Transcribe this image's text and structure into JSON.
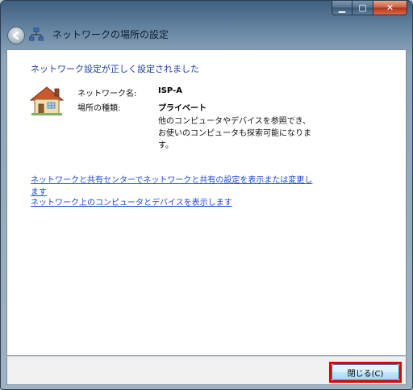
{
  "window": {
    "title": "ネットワークの場所の設定",
    "caption_buttons": {
      "minimize": "▁",
      "maximize": "▢",
      "close": "✕"
    }
  },
  "main": {
    "heading": "ネットワーク設定が正しく設定されました",
    "network_name_label": "ネットワーク名:",
    "network_name_value": "ISP-A",
    "location_type_label": "場所の種類:",
    "location_type_value": "プライベート",
    "description_line1": "他のコンピュータやデバイスを参照でき、",
    "description_line2": "お使いのコンピュータも探索可能になりま",
    "description_line3": "す。",
    "links": {
      "sharing_center_line1": "ネットワークと共有センターでネットワークと共有の設定を表示または変更し",
      "sharing_center_line2": "ます",
      "view_computers": "ネットワーク上のコンピュータとデバイスを表示します"
    }
  },
  "footer": {
    "close_button_label": "閉じる(C)"
  },
  "icons": {
    "back": "back-arrow-icon",
    "network": "network-icon",
    "location": "home-icon"
  },
  "colors": {
    "link": "#1a4ad6",
    "heading": "#1a3f9e",
    "highlight": "#e40000"
  }
}
